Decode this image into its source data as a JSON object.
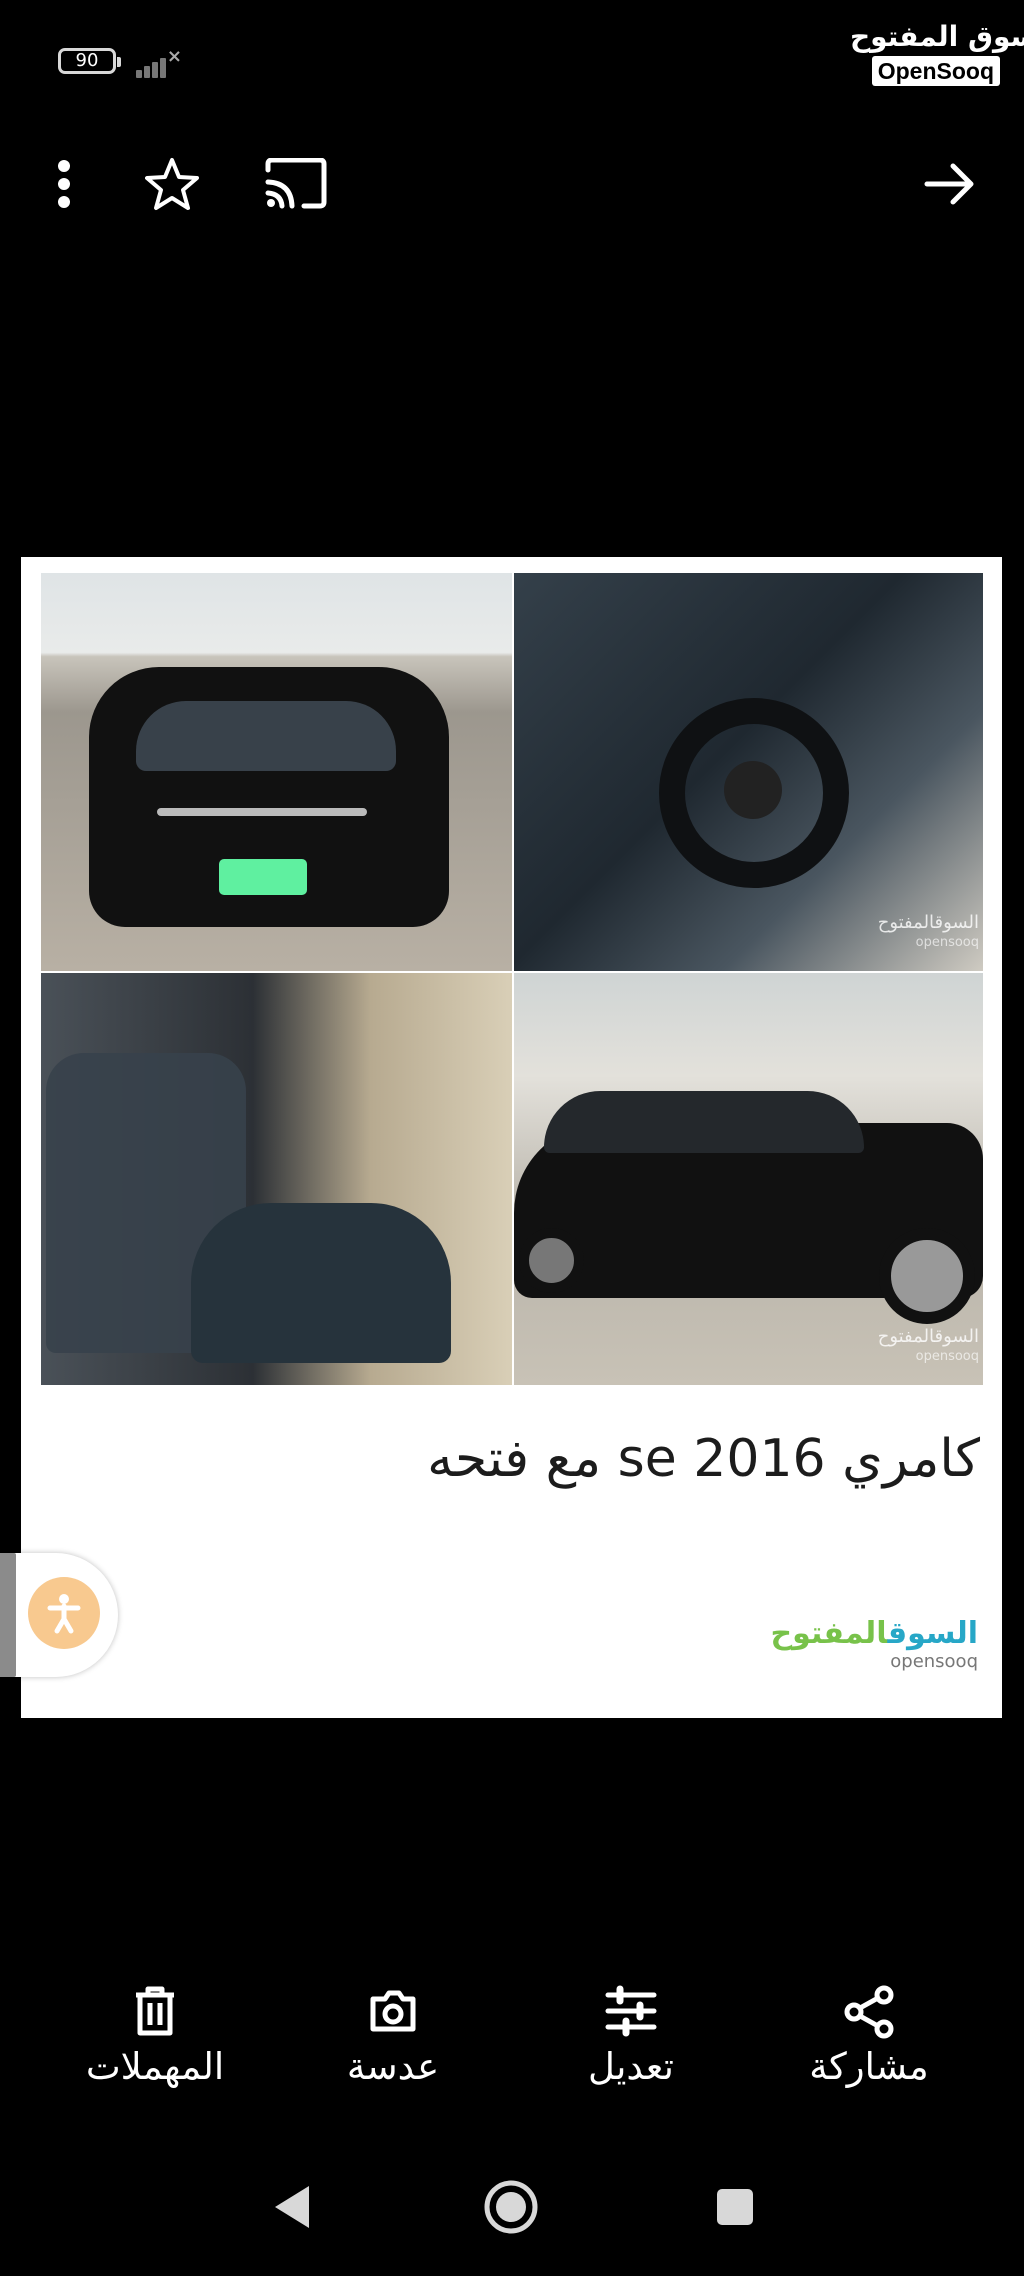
{
  "status": {
    "battery_level": "90"
  },
  "brand": {
    "arabic_name": "السوق المفتوح",
    "english_name": "OpenSooq"
  },
  "listing": {
    "title": "كامري se 2016 مع فتحه"
  },
  "watermark": {
    "arabic_name_blue": "السوق",
    "arabic_name_green": "المفتوح",
    "english_name": "opensooq"
  },
  "bottom_actions": [
    {
      "label": "المهملات",
      "icon": "trash-icon"
    },
    {
      "label": "عدسة",
      "icon": "lens-icon"
    },
    {
      "label": "تعديل",
      "icon": "adjust-icon"
    },
    {
      "label": "مشاركة",
      "icon": "share-icon"
    }
  ],
  "colors": {
    "background": "#000000",
    "card": "#ffffff",
    "accessibility": "#f8c98f"
  }
}
